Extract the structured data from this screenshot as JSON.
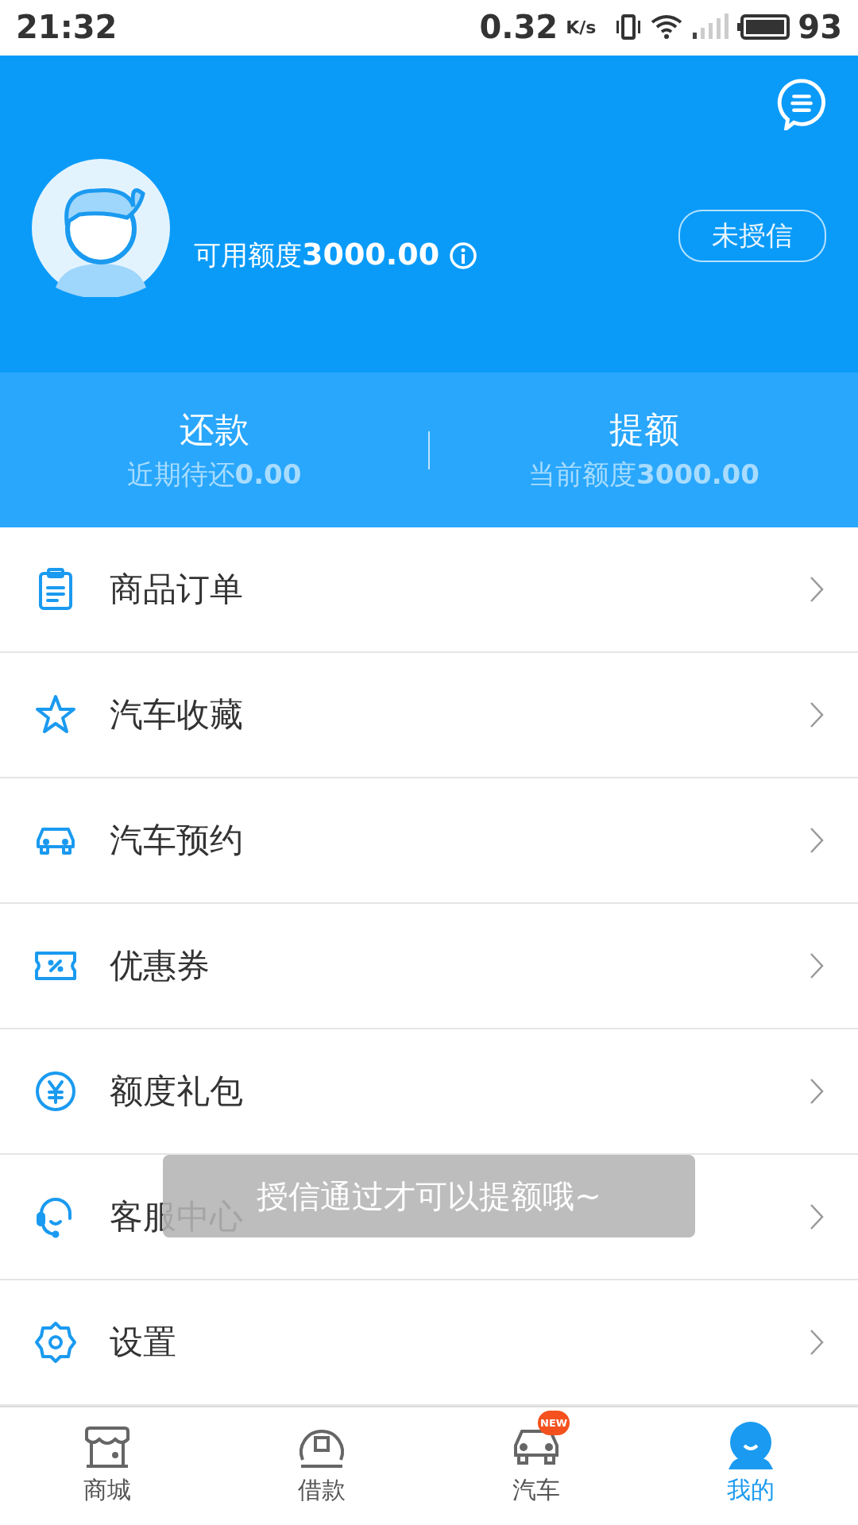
{
  "status_bar": {
    "time": "21:32",
    "speed": "0.32",
    "speed_unit": "K/s",
    "battery": "93"
  },
  "profile": {
    "credit_label": "可用额度",
    "credit_value": "3000.00",
    "status_button": "未授信"
  },
  "stats": [
    {
      "title": "还款",
      "sub_label": "近期待还",
      "sub_value": "0.00"
    },
    {
      "title": "提额",
      "sub_label": "当前额度",
      "sub_value": "3000.00"
    }
  ],
  "menu": [
    {
      "kind": "order",
      "label": "商品订单"
    },
    {
      "kind": "star",
      "label": "汽车收藏"
    },
    {
      "kind": "car",
      "label": "汽车预约"
    },
    {
      "kind": "coupon",
      "label": "优惠券"
    },
    {
      "kind": "yen",
      "label": "额度礼包"
    },
    {
      "kind": "service",
      "label": "客服中心"
    },
    {
      "kind": "settings",
      "label": "设置"
    }
  ],
  "toast": "授信通过才可以提额哦~",
  "tabs": [
    {
      "kind": "shop",
      "label": "商城",
      "selected": false
    },
    {
      "kind": "loan",
      "label": "借款",
      "selected": false
    },
    {
      "kind": "car",
      "label": "汽车",
      "selected": false,
      "badge": "NEW"
    },
    {
      "kind": "me",
      "label": "我的",
      "selected": true
    }
  ]
}
